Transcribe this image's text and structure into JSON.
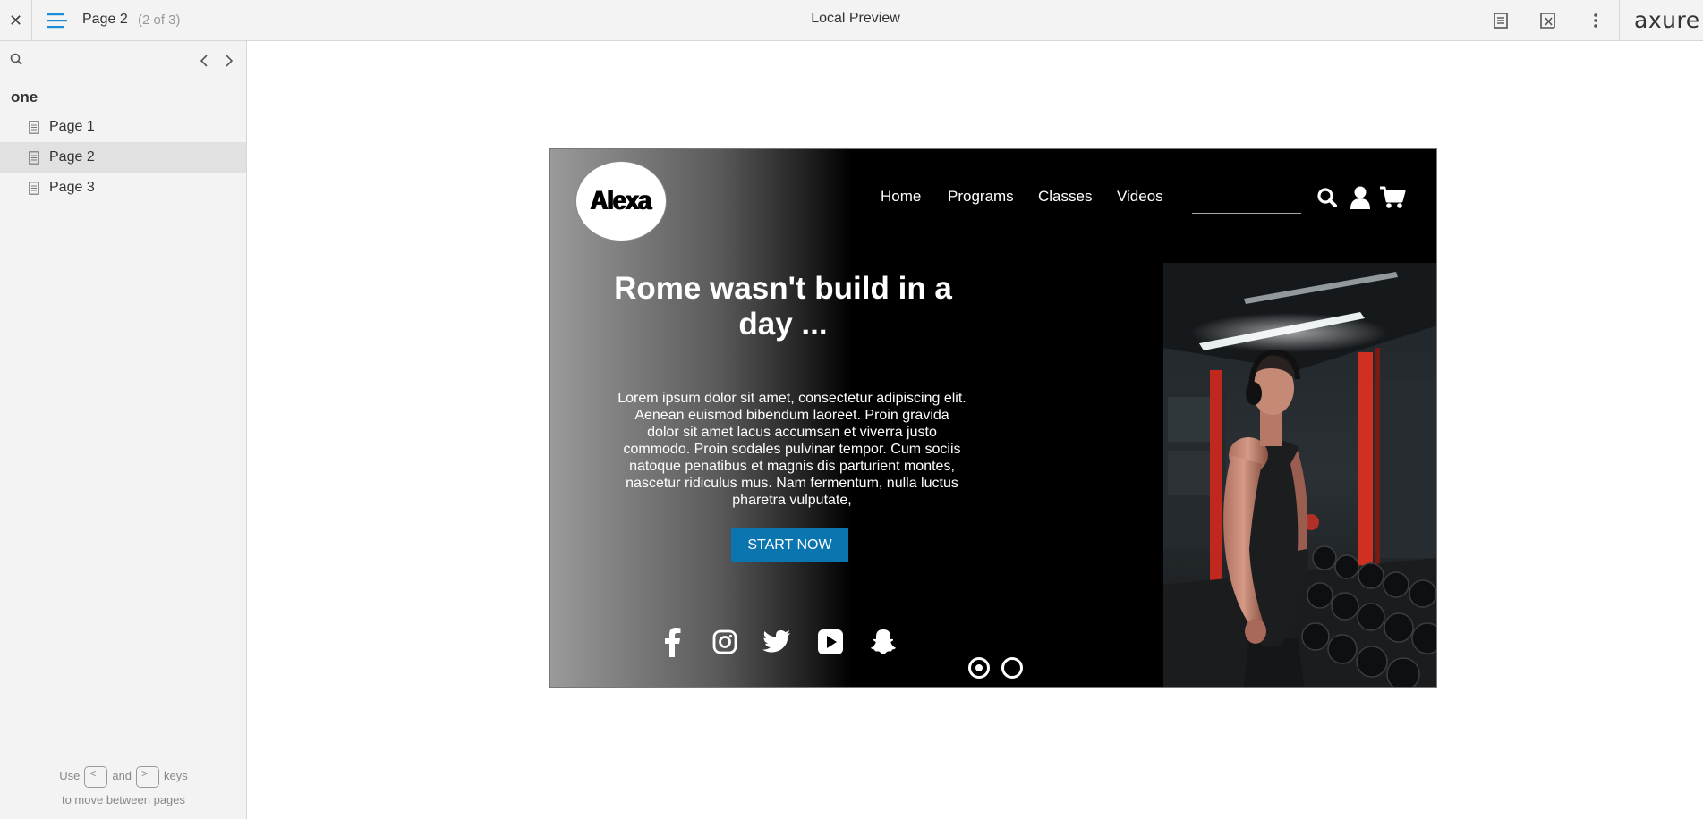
{
  "topbar": {
    "close_icon": "close-icon",
    "menu_icon": "hamburger-menu-icon",
    "page_name": "Page 2",
    "page_count": "(2 of 3)",
    "title": "Local Preview",
    "actions": [
      "notes-icon",
      "variables-icon",
      "more-icon"
    ],
    "brand": "axure",
    "accent": "#1a8dd8"
  },
  "sidebar": {
    "folder": "one",
    "items": [
      {
        "label": "Page 1"
      },
      {
        "label": "Page 2",
        "active": true
      },
      {
        "label": "Page 3"
      }
    ],
    "hint": {
      "use": "Use",
      "and": "and",
      "keys": "keys",
      "line2": "to move between pages",
      "prev_key": "<",
      "next_key": ">"
    }
  },
  "prototype": {
    "logo": "Alexa",
    "nav": [
      "Home",
      "Programs",
      "Classes",
      "Videos"
    ],
    "search_value": "",
    "header_icons": [
      "search-icon",
      "user-icon",
      "cart-icon"
    ],
    "hero_title": "Rome wasn't build in a day ...",
    "hero_text": "Lorem ipsum dolor sit amet, consectetur adipiscing elit. Aenean euismod bibendum laoreet. Proin gravida dolor sit amet lacus accumsan et viverra justo commodo. Proin sodales pulvinar tempor. Cum sociis natoque penatibus et magnis dis parturient montes, nascetur ridiculus mus. Nam fermentum, nulla luctus pharetra vulputate,",
    "cta": "START NOW",
    "cta_color": "#0b75b0",
    "social": [
      "facebook-icon",
      "instagram-icon",
      "twitter-icon",
      "youtube-icon",
      "snapchat-icon"
    ],
    "carousel": {
      "count": 2,
      "active": 1
    },
    "image": "gym-athlete-photo"
  }
}
